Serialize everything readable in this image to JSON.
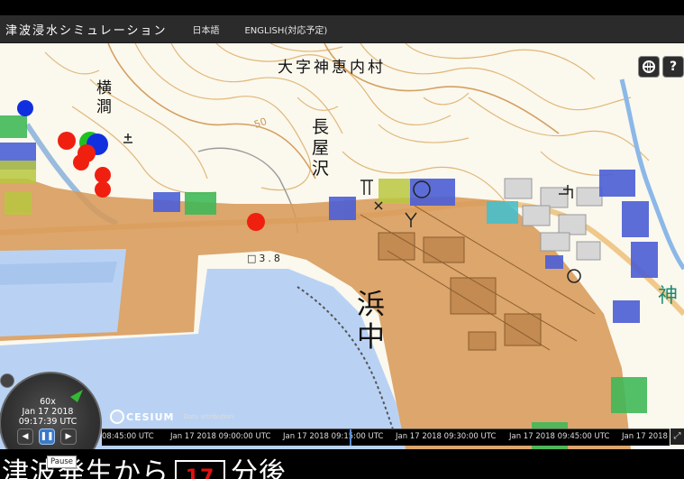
{
  "app": {
    "title": "津波浸水シミュレーション",
    "nav": {
      "japanese": "日本語",
      "english": "ENGLISH(対応予定)"
    }
  },
  "map": {
    "labels": {
      "village": "大字神恵内村",
      "yokoma": "横澗",
      "nagayasawa": "長屋沢",
      "hamanaka": "浜中",
      "kamui": "神",
      "contour_50": "50",
      "benchmark": "□3.8"
    },
    "tools": {
      "geocoder_icon": "globe-icon",
      "help_label": "?"
    }
  },
  "animation": {
    "speed": "60x",
    "date": "Jan 17 2018",
    "time": "09:17:39 UTC",
    "pause_tooltip": "Pause"
  },
  "timeline": {
    "ticks": [
      "08:45:00 UTC",
      "Jan 17 2018 09:00:00 UTC",
      "Jan 17 2018 09:15:00 UTC",
      "Jan 17 2018 09:30:00 UTC",
      "Jan 17 2018 09:45:00 UTC",
      "Jan 17 2018 10:00"
    ]
  },
  "credits": {
    "logo": "CESIUM",
    "attribution": "Data attribution"
  },
  "subtitle": {
    "prefix": "津波発生から",
    "minutes": "17",
    "suffix": "分後"
  },
  "colors": {
    "inundation": "#d79a5a",
    "sea": "#b9d2f4",
    "nav_bg": "#2b2b2b",
    "timeline_needle": "#5a8fd6",
    "marker_red": "#f02010",
    "marker_blue": "#1030e0",
    "marker_green": "#20c020"
  }
}
